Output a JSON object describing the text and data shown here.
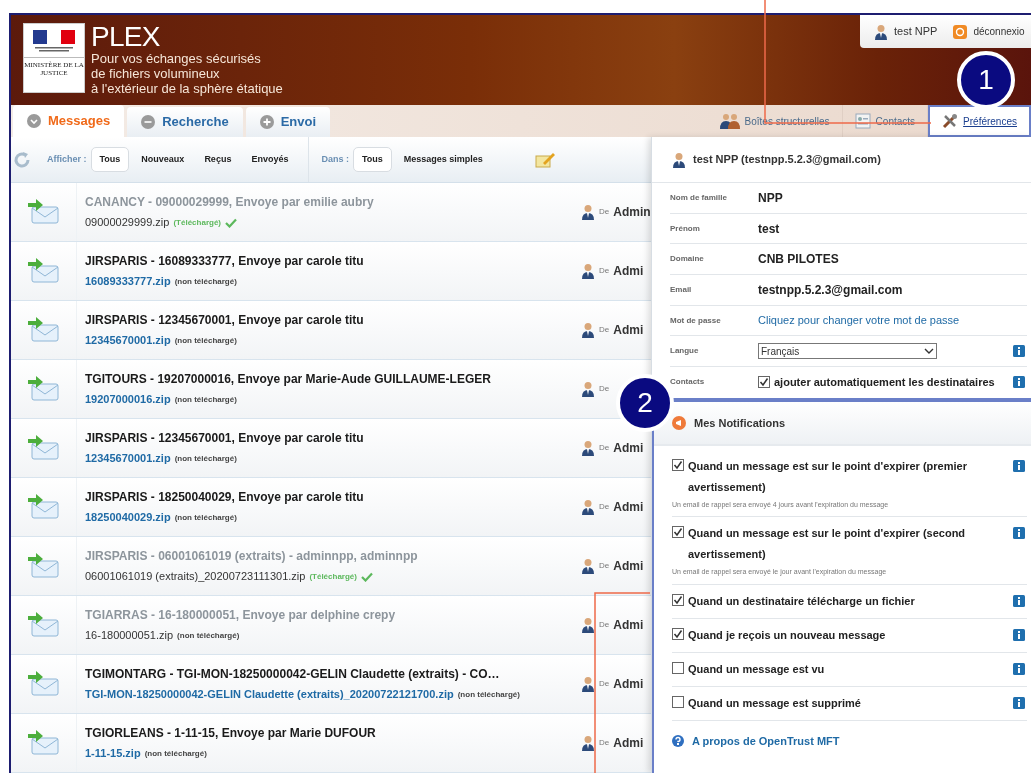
{
  "header": {
    "ministry": "MINISTÈRE DE LA JUSTICE",
    "app_name": "PLEX",
    "tagline": [
      "Pour vos échanges sécurisés",
      "de fichiers volumineux",
      "à l'extérieur de la sphère étatique"
    ],
    "user": "test NPP",
    "logout": "déconnexio"
  },
  "tabs": [
    {
      "label": "Messages",
      "selected": true,
      "kind": "down"
    },
    {
      "label": "Recherche",
      "selected": false,
      "kind": "minus"
    },
    {
      "label": "Envoi",
      "selected": false,
      "kind": "plus"
    }
  ],
  "nav": [
    {
      "label": "Boîtes structurelles",
      "selected": false,
      "kind": "group"
    },
    {
      "label": "Contacts",
      "selected": false,
      "kind": "card"
    },
    {
      "label": "Préférences",
      "selected": true,
      "kind": "tools"
    }
  ],
  "toolbar": {
    "show_label": "Afficher :",
    "show_filters": [
      {
        "label": "Tous",
        "selected": true
      },
      {
        "label": "Nouveaux",
        "selected": false
      },
      {
        "label": "Reçus",
        "selected": false
      },
      {
        "label": "Envoyés",
        "selected": false
      }
    ],
    "in_label": "Dans :",
    "in_filters": [
      {
        "label": "Tous",
        "selected": true
      },
      {
        "label": "Messages simples",
        "selected": false
      }
    ]
  },
  "messages": [
    {
      "title": "CANANCY - 09000029999, Envoye par emilie aubry",
      "file": "09000029999.zip",
      "status": "(Téléchargé)",
      "read": true,
      "downloaded": true,
      "from": "De",
      "sender": "Admin"
    },
    {
      "title": "JIRSPARIS - 16089333777, Envoye par carole titu",
      "file": "16089333777.zip",
      "status": "(non téléchargé)",
      "read": false,
      "downloaded": false,
      "from": "De",
      "sender": "Admi"
    },
    {
      "title": "JIRSPARIS - 12345670001, Envoye par carole titu",
      "file": "12345670001.zip",
      "status": "(non téléchargé)",
      "read": false,
      "downloaded": false,
      "from": "De",
      "sender": "Admi"
    },
    {
      "title": "TGITOURS - 19207000016, Envoye par Marie-Aude GUILLAUME-LEGER",
      "file": "19207000016.zip",
      "status": "(non téléchargé)",
      "read": false,
      "downloaded": false,
      "from": "De"
    },
    {
      "title": "JIRSPARIS - 12345670001, Envoye par carole titu",
      "file": "12345670001.zip",
      "status": "(non téléchargé)",
      "read": false,
      "downloaded": false,
      "from": "De",
      "sender": "Admi"
    },
    {
      "title": "JIRSPARIS - 18250040029, Envoye par carole titu",
      "file": "18250040029.zip",
      "status": "(non téléchargé)",
      "read": false,
      "downloaded": false,
      "from": "De",
      "sender": "Admi"
    },
    {
      "title": "JIRSPARIS - 06001061019 (extraits) - adminnpp, adminnpp",
      "file": "06001061019 (extraits)_20200723111301.zip",
      "status": "(Téléchargé)",
      "read": true,
      "downloaded": true,
      "from": "De",
      "sender": "Admi"
    },
    {
      "title": "TGIARRAS - 16-180000051, Envoye par delphine crepy",
      "file": "16-180000051.zip",
      "status": "(non téléchargé)",
      "read": true,
      "downloaded": false,
      "from": "De",
      "sender": "Admi"
    },
    {
      "title": "TGIMONTARG - TGI-MON-18250000042-GELIN Claudette (extraits) - CO…",
      "file": "TGI-MON-18250000042-GELIN Claudette (extraits)_20200722121700.zip",
      "status": "(non téléchargé)",
      "read": false,
      "downloaded": false,
      "from": "De",
      "sender": "Admi"
    },
    {
      "title": "TGIORLEANS - 1-11-15, Envoye par Marie DUFOUR",
      "file": "1-11-15.zip",
      "status": "(non téléchargé)",
      "read": false,
      "downloaded": false,
      "from": "De",
      "sender": "Admi"
    }
  ],
  "profile": {
    "heading": "test NPP (testnpp.5.2.3@gmail.com)",
    "fields": [
      {
        "label": "Nom de famille",
        "value": "NPP",
        "kind": "text"
      },
      {
        "label": "Prénom",
        "value": "test",
        "kind": "text"
      },
      {
        "label": "Domaine",
        "value": "CNB PILOTES",
        "kind": "text"
      },
      {
        "label": "Email",
        "value": "testnpp.5.2.3@gmail.com",
        "kind": "text"
      },
      {
        "label": "Mot de passe",
        "value": "Cliquez pour changer votre mot de passe",
        "kind": "link"
      },
      {
        "label": "Langue",
        "value": "Français",
        "kind": "select"
      },
      {
        "label": "Contacts",
        "value": "ajouter automatiquement les destinataires",
        "kind": "checkbox",
        "checked": true
      }
    ]
  },
  "notifications": {
    "heading": "Mes Notifications",
    "items": [
      {
        "label": "Quand un message est sur le point d'expirer (premier avertissement)",
        "hint": "Un email de rappel sera envoyé 4 jours avant l'expiration du message",
        "checked": true
      },
      {
        "label": "Quand un message est sur le point d'expirer (second avertissement)",
        "hint": "Un email de rappel sera envoyé le jour avant l'expiration du message",
        "checked": true
      },
      {
        "label": "Quand un destinataire télécharge un fichier",
        "checked": true
      },
      {
        "label": "Quand je reçois un nouveau message",
        "checked": true
      },
      {
        "label": "Quand un message est vu",
        "checked": false
      },
      {
        "label": "Quand un message est supprimé",
        "checked": false
      }
    ]
  },
  "about": "A propos de OpenTrust MFT",
  "callouts": [
    "1",
    "2"
  ]
}
